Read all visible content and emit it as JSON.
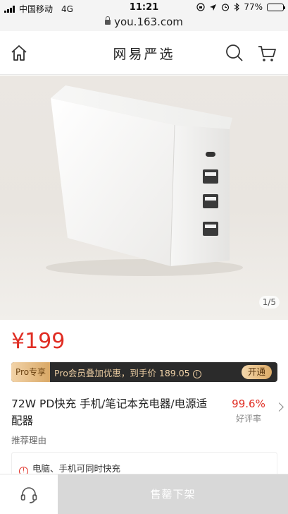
{
  "status_bar": {
    "carrier": "中国移动",
    "network": "4G",
    "time": "11:21",
    "battery": "77%",
    "battery_level": 0.77
  },
  "url_bar": {
    "url": "you.163.com"
  },
  "header": {
    "title": "网易严选",
    "icons": [
      "home-icon",
      "search-icon",
      "cart-icon"
    ]
  },
  "gallery": {
    "pager": "1/5"
  },
  "price": "¥199",
  "pro_bar": {
    "tag": "Pro专享",
    "text_prefix": "Pro会员叠加优惠，到手价",
    "final_price": "189.05",
    "action": "开通",
    "colors": {
      "bg": "#2b2b2b",
      "gold": "#e8caa0"
    }
  },
  "product": {
    "name": "72W PD快充 手机/笔记本充电器/电源适配器",
    "rating": "99.6%",
    "rating_label": "好评率"
  },
  "recommendation": {
    "title": "推荐理由",
    "first_reason": "电脑、手机可同时快充"
  },
  "bottom_bar": {
    "service_icon": "headset-icon",
    "status_button": "售罄下架"
  },
  "colors": {
    "accent_red": "#e02e24",
    "disabled_gray": "#d8d8d8"
  }
}
